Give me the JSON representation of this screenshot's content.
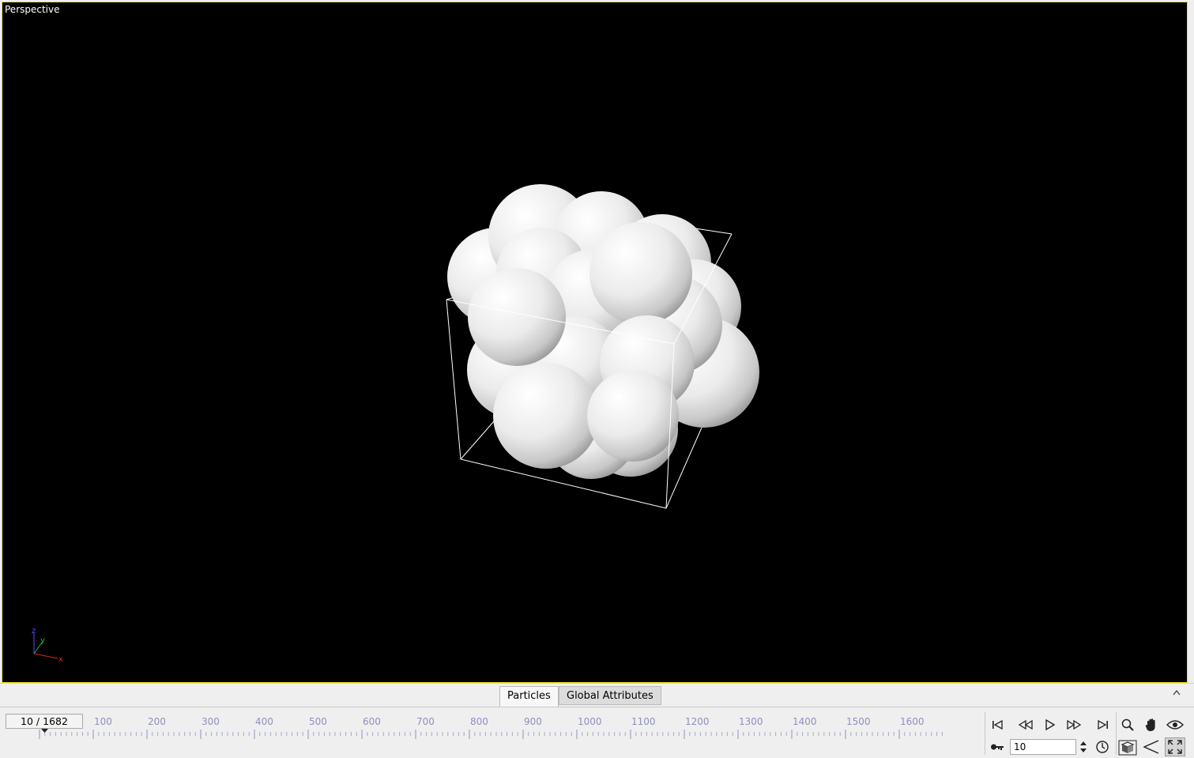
{
  "viewport": {
    "label": "Perspective",
    "axis_labels": {
      "x": "x",
      "y": "y",
      "z": "z"
    }
  },
  "tabs": [
    {
      "label": "Particles",
      "active": true
    },
    {
      "label": "Global Attributes",
      "active": false
    }
  ],
  "timeline": {
    "frame_display": "10 / 1682",
    "current_frame": 10,
    "total_frames": 1682,
    "tick_labels": [
      "100",
      "200",
      "300",
      "400",
      "500",
      "600",
      "700",
      "800",
      "900",
      "1000",
      "1100",
      "1200",
      "1300",
      "1400",
      "1500",
      "1600"
    ]
  },
  "playback": {
    "frame_input_value": "10"
  },
  "icons": {
    "first": "skip-to-start-icon",
    "prev": "step-back-icon",
    "play": "play-icon",
    "next": "step-forward-icon",
    "last": "skip-to-end-icon",
    "zoom": "magnifier-icon",
    "pan": "hand-icon",
    "orbit": "eye-icon",
    "key": "key-icon",
    "clock": "clock-icon",
    "view_cube": "view-cube-icon",
    "fov": "field-of-view-icon",
    "maximize": "maximize-icon"
  },
  "colors": {
    "viewport_border": "#f2e00b",
    "axis_x": "#e02020",
    "axis_y": "#20c020",
    "axis_z": "#5050ff",
    "tick_label": "#8f8fc0"
  }
}
